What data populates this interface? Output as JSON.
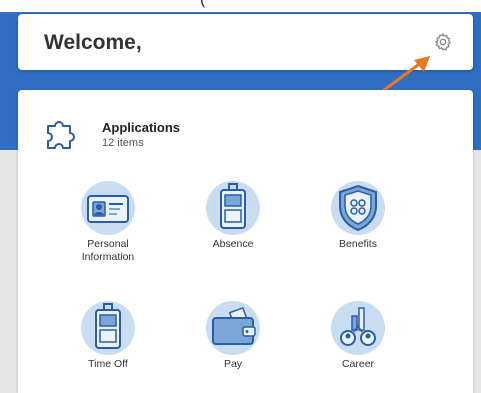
{
  "caption": "(",
  "header": {
    "welcome": "Welcome,",
    "settings_icon": "gear-icon"
  },
  "applications": {
    "title": "Applications",
    "count": "12 items",
    "icon": "puzzle-icon",
    "tiles": [
      {
        "label": "Personal Information",
        "icon": "id-card-icon"
      },
      {
        "label": "Absence",
        "icon": "luggage-icon"
      },
      {
        "label": "Benefits",
        "icon": "shield-icon"
      },
      {
        "label": "Time Off",
        "icon": "luggage-icon"
      },
      {
        "label": "Pay",
        "icon": "wallet-icon"
      },
      {
        "label": "Career",
        "icon": "career-icon"
      }
    ]
  },
  "colors": {
    "brand_blue": "#2f6ec0",
    "icon_light": "#c9ddf2",
    "icon_mid": "#7aa6d8",
    "icon_dark": "#2a5da8",
    "arrow": "#e87722"
  }
}
